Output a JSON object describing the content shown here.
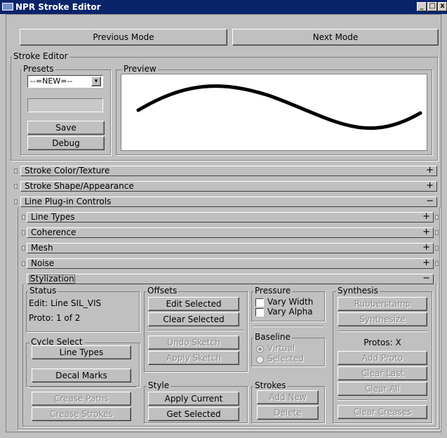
{
  "window": {
    "title": "NPR Stroke Editor",
    "minimize": "_",
    "maximize": "□",
    "close": "x"
  },
  "mode_nav": {
    "previous": "Previous Mode",
    "next": "Next Mode"
  },
  "stroke_editor": {
    "label": "Stroke Editor",
    "presets": {
      "label": "Presets",
      "selected": "--=NEW=--",
      "save": "Save",
      "debug": "Debug"
    },
    "preview": {
      "label": "Preview"
    }
  },
  "rollups": {
    "color_texture": {
      "label": "Stroke Color/Texture",
      "sign": "+"
    },
    "shape_appearance": {
      "label": "Stroke Shape/Appearance",
      "sign": "+"
    },
    "line_plugin": {
      "label": "Line Plug-in Controls",
      "sign": "−"
    },
    "line_types": {
      "label": "Line Types",
      "sign": "+"
    },
    "coherence": {
      "label": "Coherence",
      "sign": "+"
    },
    "mesh": {
      "label": "Mesh",
      "sign": "+"
    },
    "noise": {
      "label": "Noise",
      "sign": "+"
    },
    "stylization": {
      "label": "Stylization",
      "sign": "−"
    }
  },
  "status": {
    "label": "Status",
    "edit": "Edit: Line SIL_VIS",
    "proto": "Proto: 1 of 2"
  },
  "cycle_select": {
    "label": "Cycle Select",
    "line_types": "Line Types",
    "decal_marks": "Decal Marks",
    "crease_paths": "Crease Paths",
    "crease_strokes": "Crease Strokes"
  },
  "offsets": {
    "label": "Offsets",
    "edit_selected": "Edit Selected",
    "clear_selected": "Clear Selected",
    "undo_sketch": "Undo Sketch",
    "apply_sketch": "Apply Sketch"
  },
  "style": {
    "label": "Style",
    "apply_current": "Apply Current",
    "get_selected": "Get Selected"
  },
  "pressure": {
    "label": "Pressure",
    "vary_width": "Vary Width",
    "vary_alpha": "Vary Alpha"
  },
  "baseline": {
    "label": "Baseline",
    "virtual": "Virtual",
    "selected": "Selected"
  },
  "strokes": {
    "label": "Strokes",
    "add_new": "Add New",
    "delete": "Delete"
  },
  "synthesis": {
    "label": "Synthesis",
    "rubberstamp": "Rubberstamp",
    "synthesize": "Synthesize",
    "protos": "Protos: X",
    "add_proto": "Add Proto",
    "clear_last": "Clear Last",
    "clear_all": "Clear All",
    "clear_creases": "Clear Creases"
  }
}
